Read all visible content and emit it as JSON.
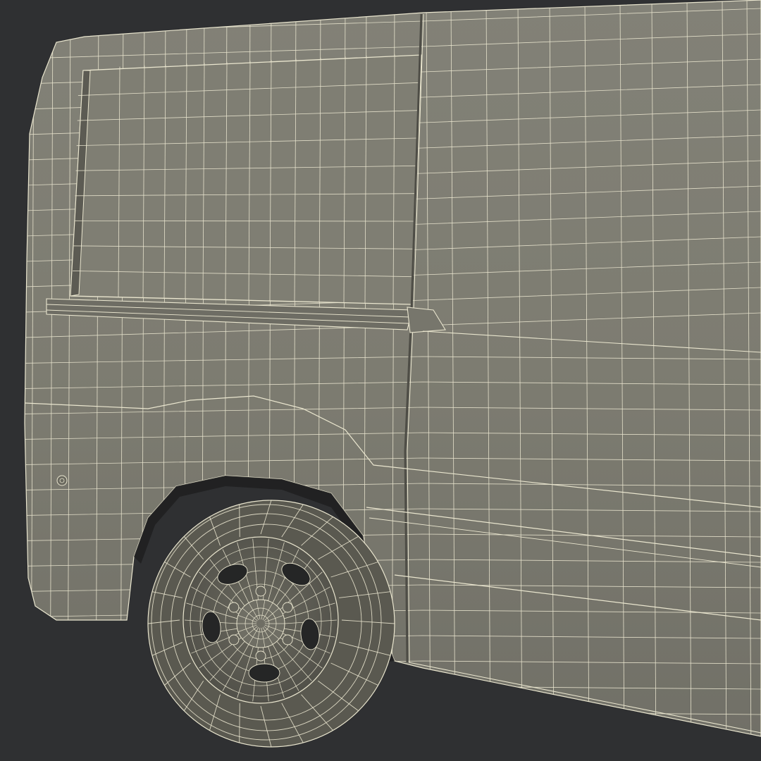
{
  "scene": {
    "subject": "wireframe-render-van-rear-quarter",
    "colors": {
      "background": "#2f3032",
      "body_fill": "#7d7c71",
      "body_fill_light": "#85847a",
      "body_fill_dark": "#6b6a61",
      "wire": "#eae6cf",
      "tire": "#55544c",
      "shadow": "#1f2021"
    }
  }
}
